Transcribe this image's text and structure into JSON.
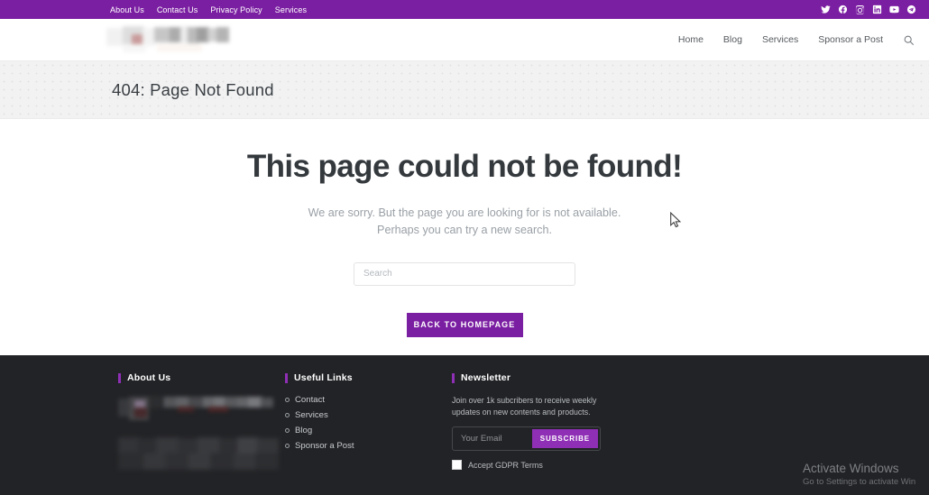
{
  "topbar": {
    "links": [
      {
        "label": "About Us"
      },
      {
        "label": "Contact Us"
      },
      {
        "label": "Privacy Policy"
      },
      {
        "label": "Services"
      }
    ],
    "social": [
      {
        "name": "twitter-icon"
      },
      {
        "name": "facebook-icon"
      },
      {
        "name": "instagram-icon"
      },
      {
        "name": "linkedin-icon"
      },
      {
        "name": "youtube-icon"
      },
      {
        "name": "telegram-icon"
      }
    ],
    "background_color": "#7B1FA2"
  },
  "header": {
    "nav": [
      {
        "label": "Home"
      },
      {
        "label": "Blog"
      },
      {
        "label": "Services"
      },
      {
        "label": "Sponsor a Post"
      }
    ],
    "search_icon": "search-icon"
  },
  "banner": {
    "title": "404: Page Not Found"
  },
  "main": {
    "heading": "This page could not be found!",
    "subtext_line1": "We are sorry. But the page you are looking for is not available.",
    "subtext_line2": "Perhaps you can try a new search.",
    "search_placeholder": "Search",
    "search_value": "",
    "home_button": "BACK TO HOMEPAGE",
    "accent_color": "#7B1FA2"
  },
  "footer": {
    "about": {
      "title": "About Us"
    },
    "useful_links": {
      "title": "Useful Links",
      "items": [
        {
          "label": "Contact"
        },
        {
          "label": "Services"
        },
        {
          "label": "Blog"
        },
        {
          "label": "Sponsor a Post"
        }
      ]
    },
    "newsletter": {
      "title": "Newsletter",
      "description": "Join over 1k subcribers to receive weekly updates on new contents and products.",
      "email_placeholder": "Your Email",
      "email_value": "",
      "subscribe_label": "SUBSCRIBE",
      "gdpr_label": "Accept GDPR Terms",
      "gdpr_checked": false
    },
    "background_color": "#222326",
    "accent_color": "#8E2FB5"
  },
  "watermark": {
    "line1": "Activate Windows",
    "line2": "Go to Settings to activate Win"
  }
}
